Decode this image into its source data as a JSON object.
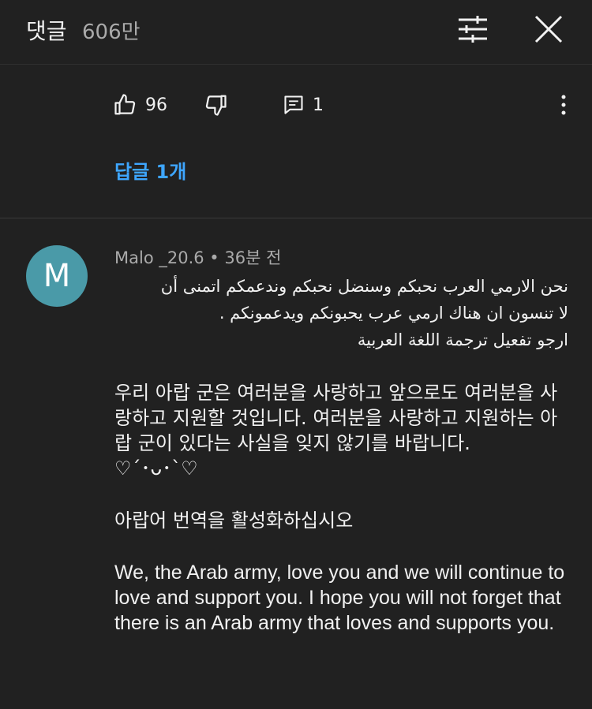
{
  "header": {
    "title": "댓글",
    "count": "606만"
  },
  "actions": {
    "like_count": "96",
    "reply_count": "1"
  },
  "replies_link": "답글 1개",
  "comment": {
    "avatar_letter": "M",
    "avatar_color": "#4a9aa8",
    "author": "Malo _20.6",
    "separator": "•",
    "time": "36분 전",
    "arabic_lines": [
      "نحن الارمي العرب نحبكم وسنضل نحبكم وندعمكم اتمنى  أن",
      "لا تنسون ان هناك ارمي عرب يحبونكم ويدعمونكم .",
      "ارجو تفعيل ترجمة اللغة العربية"
    ],
    "korean_paragraph": "우리 아랍 군은 여러분을 사랑하고 앞으로도 여러분을 사랑하고 지원할 것입니다. 여러분을 사랑하고 지원하는 아랍 군이 있다는 사실을 잊지 않기를 바랍니다.",
    "emoticon": "♡´･ᴗ･`♡",
    "korean_request": "아랍어 번역을 활성화하십시오",
    "english_paragraph": "We, the Arab army, love you and we will continue to love and support you. I hope you will not forget that there is an Arab army that loves and supports you."
  },
  "colors": {
    "background": "#212121",
    "link": "#3ea6ff",
    "secondary_text": "#aaaaaa"
  }
}
